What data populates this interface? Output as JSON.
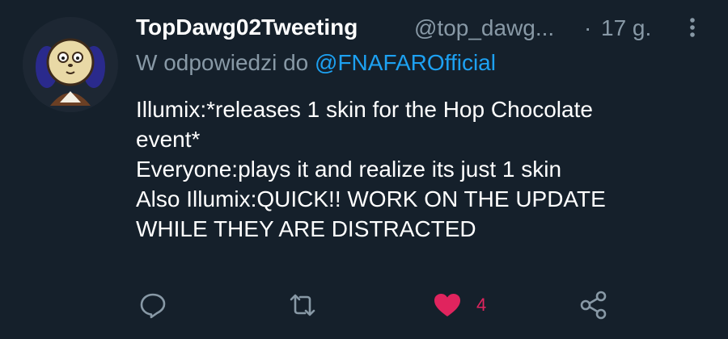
{
  "tweet": {
    "display_name": "TopDawg02Tweeting",
    "handle": "@top_dawg...",
    "separator": "·",
    "time": "17 g.",
    "reply_prefix": "W odpowiedzi do",
    "reply_mention": "@FNAFAROfficial",
    "lines": [
      "Illumix:*releases 1 skin for the Hop Chocolate",
      "event*",
      "Everyone:plays it and realize its just 1 skin",
      "Also Illumix:QUICK!! WORK ON THE UPDATE",
      "WHILE THEY ARE DISTRACTED"
    ]
  },
  "actions": {
    "reply_icon": "reply-icon",
    "retweet_icon": "retweet-icon",
    "like_icon": "heart-icon",
    "like_count": "4",
    "share_icon": "share-icon"
  },
  "colors": {
    "background": "#15202b",
    "secondary_text": "#8899a6",
    "mention": "#1da1f2",
    "like": "#e0245e"
  }
}
